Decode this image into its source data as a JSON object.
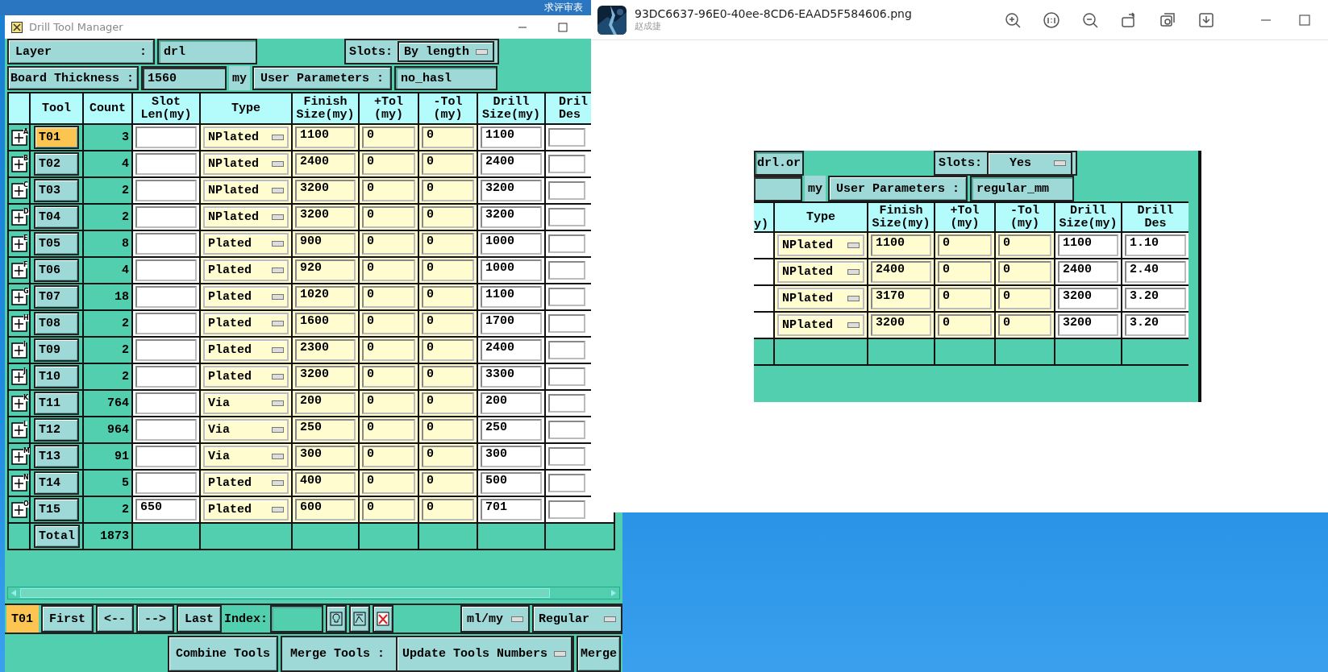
{
  "desktop": {
    "background_title": "求评审表"
  },
  "window": {
    "title": "Drill Tool Manager"
  },
  "layer": {
    "label": "Layer",
    "colon": ":",
    "value": "drl"
  },
  "slots": {
    "label": "Slots:",
    "value": "By length"
  },
  "board_thickness": {
    "label": "Board Thickness :",
    "value": "1560",
    "unit": "my"
  },
  "user_parameters": {
    "label": "User Parameters :",
    "value": "no_hasl"
  },
  "table": {
    "columns": [
      "Tool",
      "Count",
      "Slot\nLen(my)",
      "Type",
      "Finish\nSize(my)",
      "+Tol\n(my)",
      "-Tol\n(my)",
      "Drill\nSize(my)",
      "Dril\nDes"
    ],
    "rows": [
      {
        "mark": "A",
        "tool": "T01",
        "selected": true,
        "count": "3",
        "slot_len": "",
        "type": "NPlated",
        "finish": "1100",
        "plus_tol": "0",
        "minus_tol": "0",
        "drill": "1100"
      },
      {
        "mark": "B",
        "tool": "T02",
        "selected": false,
        "count": "4",
        "slot_len": "",
        "type": "NPlated",
        "finish": "2400",
        "plus_tol": "0",
        "minus_tol": "0",
        "drill": "2400"
      },
      {
        "mark": "C",
        "tool": "T03",
        "selected": false,
        "count": "2",
        "slot_len": "",
        "type": "NPlated",
        "finish": "3200",
        "plus_tol": "0",
        "minus_tol": "0",
        "drill": "3200"
      },
      {
        "mark": "D",
        "tool": "T04",
        "selected": false,
        "count": "2",
        "slot_len": "",
        "type": "NPlated",
        "finish": "3200",
        "plus_tol": "0",
        "minus_tol": "0",
        "drill": "3200"
      },
      {
        "mark": "E",
        "tool": "T05",
        "selected": false,
        "count": "8",
        "slot_len": "",
        "type": "Plated",
        "finish": "900",
        "plus_tol": "0",
        "minus_tol": "0",
        "drill": "1000"
      },
      {
        "mark": "F",
        "tool": "T06",
        "selected": false,
        "count": "4",
        "slot_len": "",
        "type": "Plated",
        "finish": "920",
        "plus_tol": "0",
        "minus_tol": "0",
        "drill": "1000"
      },
      {
        "mark": "G",
        "tool": "T07",
        "selected": false,
        "count": "18",
        "slot_len": "",
        "type": "Plated",
        "finish": "1020",
        "plus_tol": "0",
        "minus_tol": "0",
        "drill": "1100"
      },
      {
        "mark": "H",
        "tool": "T08",
        "selected": false,
        "count": "2",
        "slot_len": "",
        "type": "Plated",
        "finish": "1600",
        "plus_tol": "0",
        "minus_tol": "0",
        "drill": "1700"
      },
      {
        "mark": "I",
        "tool": "T09",
        "selected": false,
        "count": "2",
        "slot_len": "",
        "type": "Plated",
        "finish": "2300",
        "plus_tol": "0",
        "minus_tol": "0",
        "drill": "2400"
      },
      {
        "mark": "J",
        "tool": "T10",
        "selected": false,
        "count": "2",
        "slot_len": "",
        "type": "Plated",
        "finish": "3200",
        "plus_tol": "0",
        "minus_tol": "0",
        "drill": "3300"
      },
      {
        "mark": "K",
        "tool": "T11",
        "selected": false,
        "count": "764",
        "slot_len": "",
        "type": "Via",
        "finish": "200",
        "plus_tol": "0",
        "minus_tol": "0",
        "drill": "200"
      },
      {
        "mark": "L",
        "tool": "T12",
        "selected": false,
        "count": "964",
        "slot_len": "",
        "type": "Via",
        "finish": "250",
        "plus_tol": "0",
        "minus_tol": "0",
        "drill": "250"
      },
      {
        "mark": "M",
        "tool": "T13",
        "selected": false,
        "count": "91",
        "slot_len": "",
        "type": "Via",
        "finish": "300",
        "plus_tol": "0",
        "minus_tol": "0",
        "drill": "300"
      },
      {
        "mark": "N",
        "tool": "T14",
        "selected": false,
        "count": "5",
        "slot_len": "",
        "type": "Plated",
        "finish": "400",
        "plus_tol": "0",
        "minus_tol": "0",
        "drill": "500"
      },
      {
        "mark": "O",
        "tool": "T15",
        "selected": false,
        "count": "2",
        "slot_len": "650",
        "type": "Plated",
        "finish": "600",
        "plus_tol": "0",
        "minus_tol": "0",
        "drill": "701"
      }
    ],
    "total": {
      "label": "Total",
      "count": "1873"
    }
  },
  "toolbar": {
    "current_tool": "T01",
    "nav_buttons": [
      "First",
      "<--",
      "-->",
      "Last"
    ],
    "index_label": "Index:",
    "units": "ml/my",
    "mode": "Regular"
  },
  "footer": {
    "combine": "Combine Tools",
    "merge_label": "Merge Tools :",
    "merge_mode": "Update Tools Numbers",
    "merge": "Merge"
  },
  "viewer": {
    "filename": "93DC6637-96E0-40ee-8CD6-EAAD5F584606.png",
    "author": "赵成捷",
    "image": {
      "file_field": "drl.or",
      "slots_label": "Slots:",
      "slots_value": "Yes",
      "unit": "my",
      "user_parameters_label": "User Parameters :",
      "user_parameters_value": "regular_mm",
      "columns": [
        "y)",
        "Type",
        "Finish\nSize(my)",
        "+Tol\n(my)",
        "-Tol\n(my)",
        "Drill\nSize(my)",
        "Drill\nDes"
      ],
      "rows": [
        {
          "type": "NPlated",
          "finish": "1100",
          "plus_tol": "0",
          "minus_tol": "0",
          "drill": "1100",
          "drill_des": "1.10"
        },
        {
          "type": "NPlated",
          "finish": "2400",
          "plus_tol": "0",
          "minus_tol": "0",
          "drill": "2400",
          "drill_des": "2.40"
        },
        {
          "type": "NPlated",
          "finish": "3170",
          "plus_tol": "0",
          "minus_tol": "0",
          "drill": "3200",
          "drill_des": "3.20"
        },
        {
          "type": "NPlated",
          "finish": "3200",
          "plus_tol": "0",
          "minus_tol": "0",
          "drill": "3200",
          "drill_des": "3.20"
        }
      ]
    }
  }
}
